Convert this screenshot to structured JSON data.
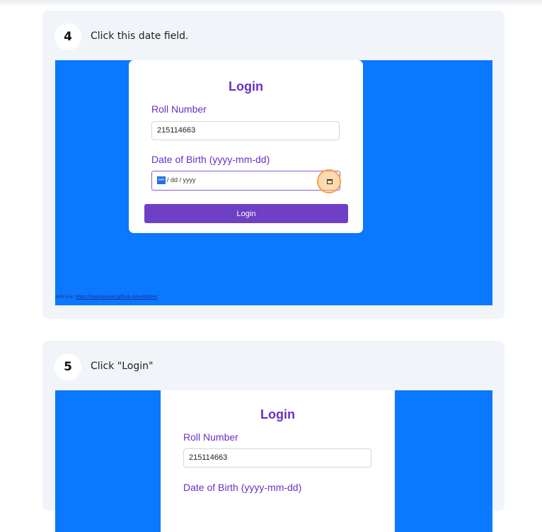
{
  "steps": [
    {
      "number": "4",
      "instruction": "Click this date field.",
      "screenshot": {
        "login_title": "Login",
        "roll_label": "Roll Number",
        "roll_value": "215114663",
        "dob_label": "Date of Birth (yyyy-mm-dd)",
        "dob_mm": "mm",
        "dob_rest": "/ dd / yyyy",
        "button_label": "Login",
        "credit_prefix": "with link:",
        "credit_link": "https://ravimanivel.github.io/websites/"
      }
    },
    {
      "number": "5",
      "instruction": "Click \"Login\"",
      "screenshot": {
        "login_title": "Login",
        "roll_label": "Roll Number",
        "roll_value": "215114663",
        "dob_label": "Date of Birth (yyyy-mm-dd)"
      }
    }
  ],
  "colors": {
    "accent_purple": "#6a2fc9",
    "button_purple": "#6f3fc5",
    "screenshot_blue": "#0a78ff",
    "highlight_orange": "#f5a04a",
    "card_bg": "#f1f4f8"
  },
  "icons": {
    "calendar": "calendar-icon"
  }
}
